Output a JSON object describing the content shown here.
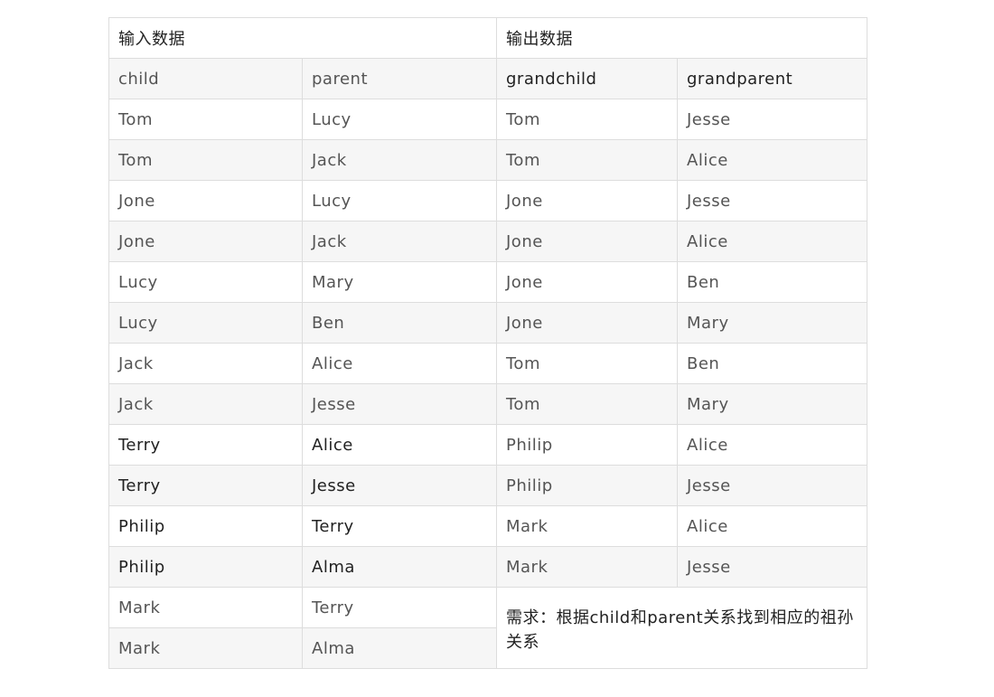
{
  "header": {
    "input_title": "输入数据",
    "output_title": "输出数据"
  },
  "input": {
    "columns": [
      "child",
      "parent"
    ],
    "rows": [
      [
        "Tom",
        "Lucy"
      ],
      [
        "Tom",
        "Jack"
      ],
      [
        "Jone",
        "Lucy"
      ],
      [
        "Jone",
        "Jack"
      ],
      [
        "Lucy",
        "Mary"
      ],
      [
        "Lucy",
        "Ben"
      ],
      [
        "Jack",
        "Alice"
      ],
      [
        "Jack",
        "Jesse"
      ],
      [
        "Terry",
        "Alice"
      ],
      [
        "Terry",
        "Jesse"
      ],
      [
        "Philip",
        "Terry"
      ],
      [
        "Philip",
        "Alma"
      ],
      [
        "Mark",
        "Terry"
      ],
      [
        "Mark",
        "Alma"
      ]
    ]
  },
  "output": {
    "columns": [
      "grandchild",
      "grandparent"
    ],
    "rows": [
      [
        "Tom",
        "Jesse"
      ],
      [
        "Tom",
        "Alice"
      ],
      [
        "Jone",
        "Jesse"
      ],
      [
        "Jone",
        "Alice"
      ],
      [
        "Jone",
        "Ben"
      ],
      [
        "Jone",
        "Mary"
      ],
      [
        "Tom",
        "Ben"
      ],
      [
        "Tom",
        "Mary"
      ],
      [
        "Philip",
        "Alice"
      ],
      [
        "Philip",
        "Jesse"
      ],
      [
        "Mark",
        "Alice"
      ],
      [
        "Mark",
        "Jesse"
      ]
    ]
  },
  "note": "需求：根据child和parent关系找到相应的祖孙关系"
}
